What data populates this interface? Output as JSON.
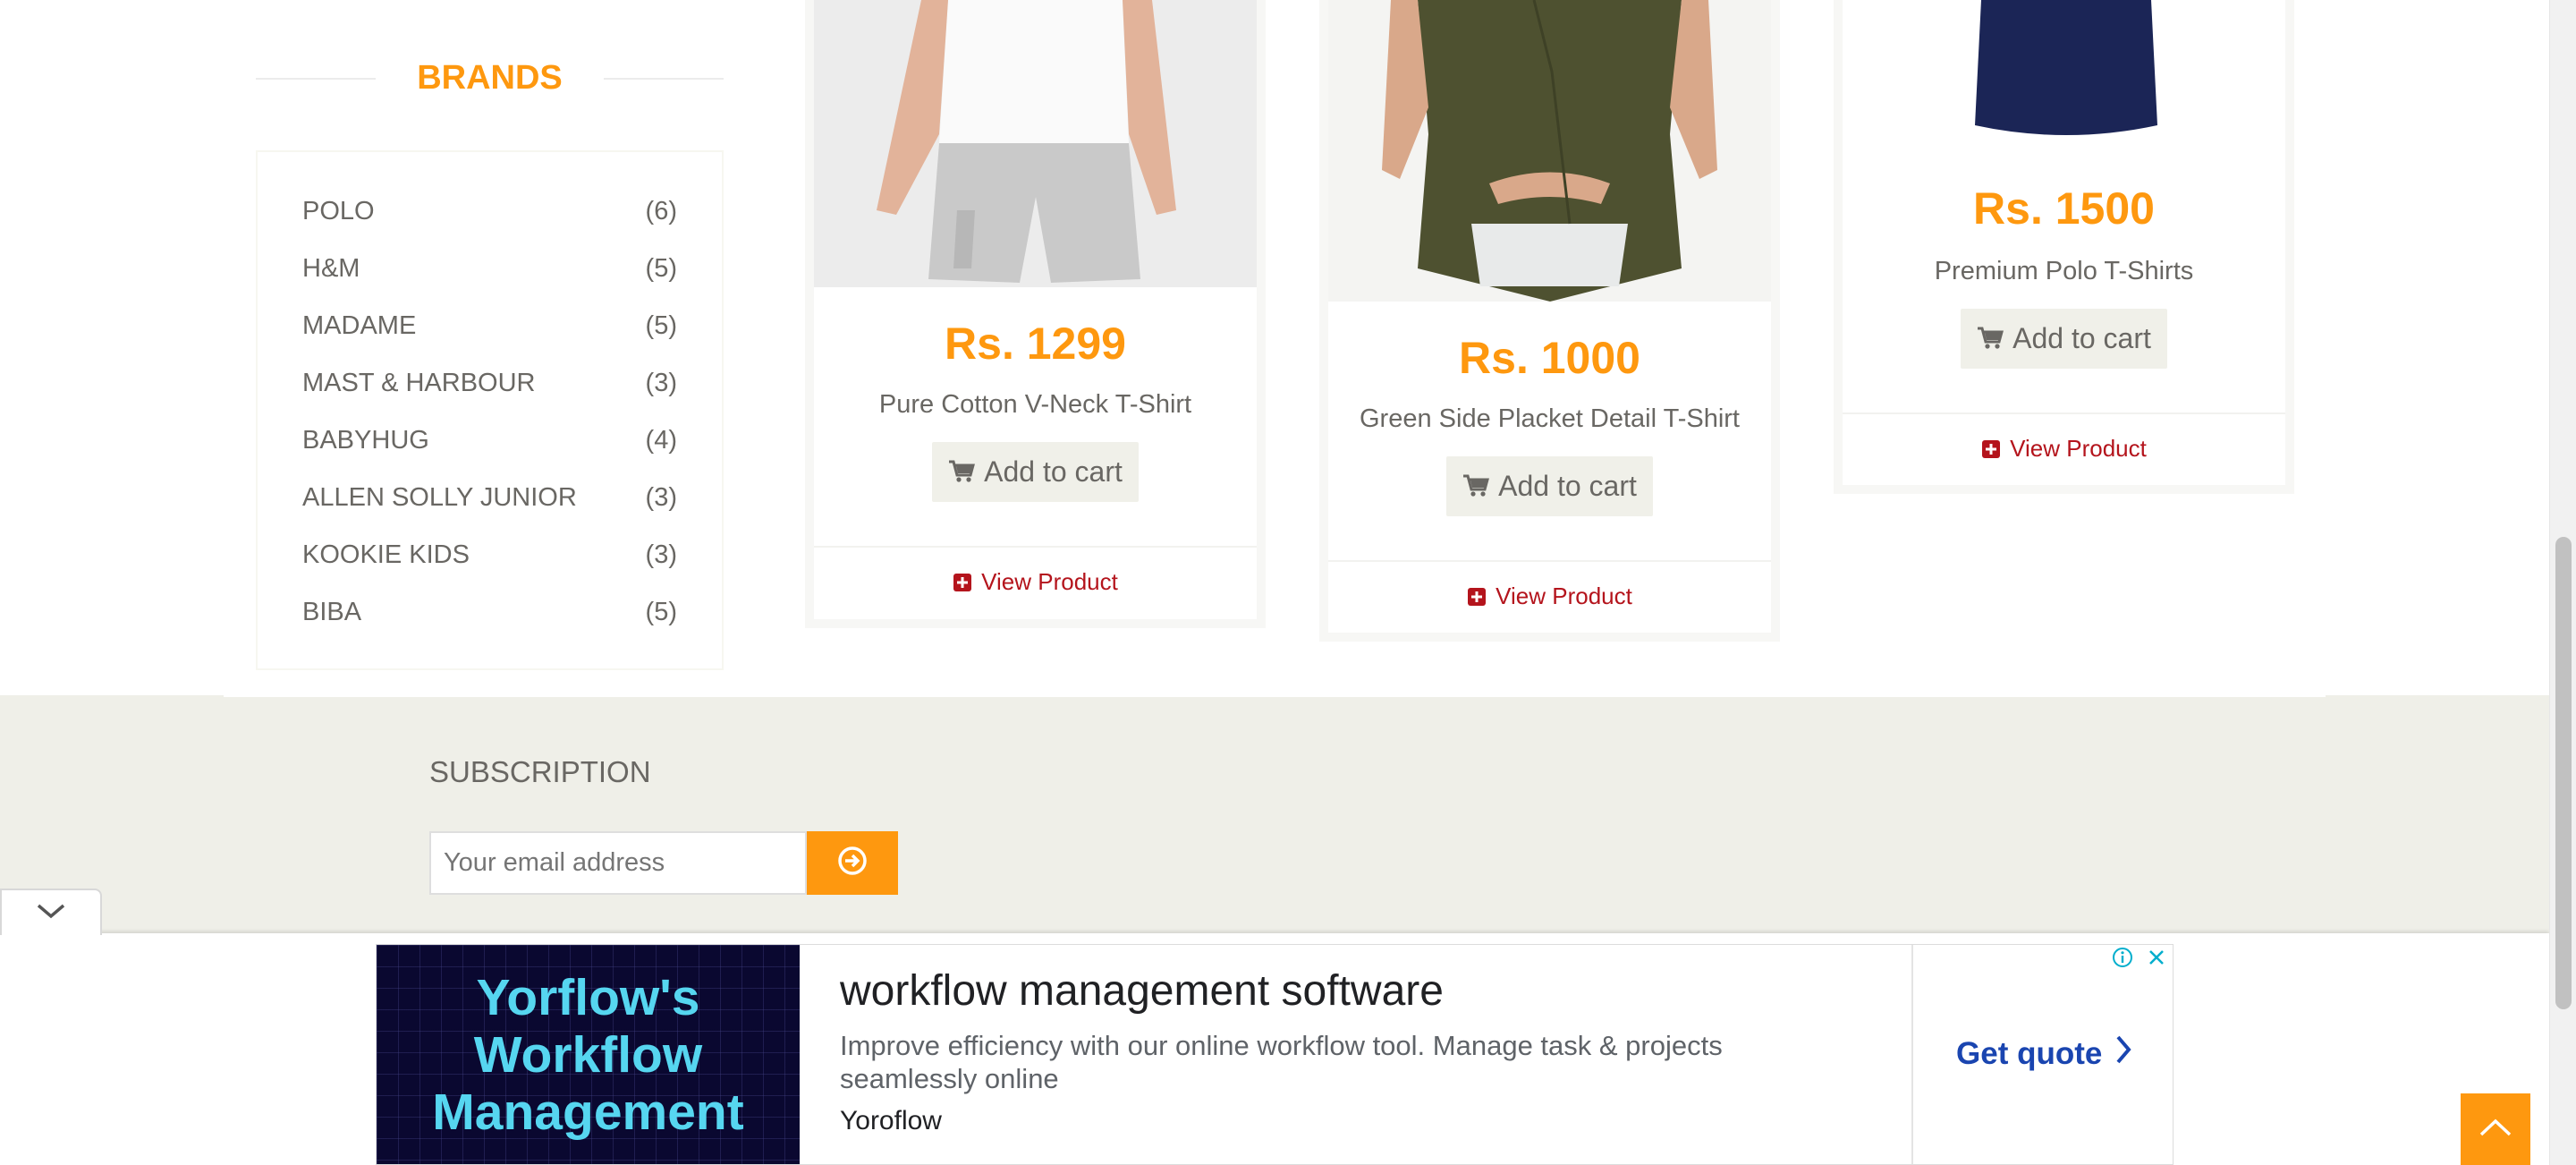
{
  "sidebar": {
    "brands_title": "BRANDS",
    "brands": [
      {
        "name": "POLO",
        "count": "(6)"
      },
      {
        "name": "H&M",
        "count": "(5)"
      },
      {
        "name": "MADAME",
        "count": "(5)"
      },
      {
        "name": "MAST & HARBOUR",
        "count": "(3)"
      },
      {
        "name": "BABYHUG",
        "count": "(4)"
      },
      {
        "name": "ALLEN SOLLY JUNIOR",
        "count": "(3)"
      },
      {
        "name": "KOOKIE KIDS",
        "count": "(3)"
      },
      {
        "name": "BIBA",
        "count": "(5)"
      }
    ]
  },
  "products": [
    {
      "price": "Rs. 1299",
      "name": "Pure Cotton V-Neck T-Shirt",
      "add_to_cart": "Add to cart",
      "view_product": "View Product"
    },
    {
      "price": "Rs. 1000",
      "name": "Green Side Placket Detail T-Shirt",
      "add_to_cart": "Add to cart",
      "view_product": "View Product"
    },
    {
      "price": "Rs. 1500",
      "name": "Premium Polo T-Shirts",
      "add_to_cart": "Add to cart",
      "view_product": "View Product"
    }
  ],
  "subscription": {
    "title": "SUBSCRIPTION",
    "placeholder": "Your email address"
  },
  "ad": {
    "image_text": "Yorflow's Workflow Management",
    "headline": "workflow management software",
    "description": "Improve efficiency with our online workflow tool. Manage task & projects seamlessly online",
    "advertiser": "Yoroflow",
    "cta": "Get quote"
  },
  "colors": {
    "accent": "#FE980F",
    "link_red": "#B4141C",
    "footer_bg": "#EFEFE8",
    "ad_cta_blue": "#1A45B0"
  },
  "icons": {
    "cart": "shopping-cart-icon",
    "view": "plus-square-icon",
    "subscribe": "arrow-circle-right-icon",
    "collapse": "chevron-down-icon",
    "back_to_top": "chevron-up-icon",
    "ad_info": "info-icon",
    "ad_close": "close-icon"
  }
}
